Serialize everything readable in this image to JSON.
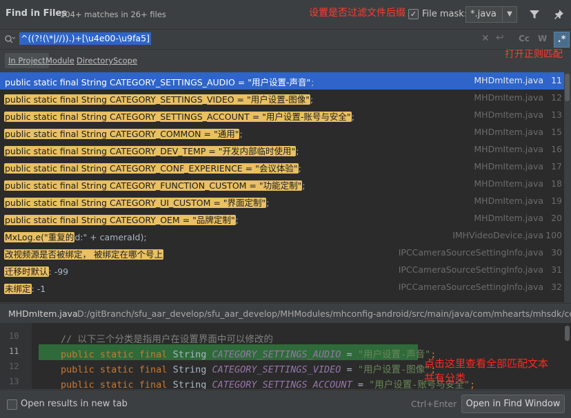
{
  "header": {
    "title": "Find in Files",
    "matches": "104+ matches in 26+ files",
    "file_mask_label": "File mask:",
    "file_mask_value": "*.java",
    "file_mask_checked": true
  },
  "annotations": {
    "filter": "设置是否过滤文件后缀",
    "regex": "打开正则匹配",
    "detail": "点击这里查看全部匹配文本共有分类"
  },
  "search": {
    "query": "^((?!(\\*|//)).)+[\\u4e00-\\u9fa5]",
    "cc_label": "Cc",
    "word_label": "W",
    "regex_label": ".*",
    "regex_enabled": true
  },
  "scopes": [
    "In Project",
    "Module",
    "Directory",
    "Scope"
  ],
  "results": [
    {
      "match": "public static final String CATEGORY_SETTINGS_AUDIO = \"用户设置-声音\"",
      "rest": ";",
      "file": "MHDmItem.java",
      "line": "11",
      "selected": true
    },
    {
      "match": "public static final String CATEGORY_SETTINGS_VIDEO = \"用户设置-图像\"",
      "rest": ";",
      "file": "MHDmItem.java",
      "line": "12"
    },
    {
      "match": "public static final String CATEGORY_SETTINGS_ACCOUNT = \"用户设置-账号与安全\"",
      "rest": ";",
      "file": "MHDmItem.java",
      "line": "13"
    },
    {
      "match": "public static final String CATEGORY_COMMON = \"通用\"",
      "rest": ";",
      "file": "MHDmItem.java",
      "line": "15"
    },
    {
      "match": "public static final String CATEGORY_DEV_TEMP = \"开发内部临时使用\"",
      "rest": ";",
      "file": "MHDmItem.java",
      "line": "16"
    },
    {
      "match": "public static final String CATEGORY_CONF_EXPERIENCE = \"会议体验\"",
      "rest": ";",
      "file": "MHDmItem.java",
      "line": "17"
    },
    {
      "match": "public static final String CATEGORY_FUNCTION_CUSTOM = \"功能定制\"",
      "rest": ";",
      "file": "MHDmItem.java",
      "line": "18"
    },
    {
      "match": "public static final String CATEGORY_UI_CUSTOM = \"界面定制\"",
      "rest": ";",
      "file": "MHDmItem.java",
      "line": "19"
    },
    {
      "match": "public static final String CATEGORY_OEM = \"品牌定制\"",
      "rest": ";",
      "file": "MHDmItem.java",
      "line": "20"
    },
    {
      "match": "MxLog.e(\"重复的",
      "rest": "d:\" + cameraId);",
      "file": "IMHVideoDevice.java",
      "line": "100"
    },
    {
      "match": "改视频源是否被绑定， 被绑定在哪个号上",
      "rest": "",
      "file": "IPCCameraSourceSettingInfo.java",
      "line": "30"
    },
    {
      "match": "迁移时默认",
      "rest": ": -99",
      "file": "IPCCameraSourceSettingInfo.java",
      "line": "31"
    },
    {
      "match": "未绑定",
      "rest": ": -1",
      "file": "IPCCameraSourceSettingInfo.java",
      "line": "32"
    }
  ],
  "path_bar": {
    "file": "MHDmItem.java",
    "dir": "D:/gitBranch/sfu_aar_develop/sfu_aar_develop/MHModules/mhconfig-android/src/main/java/com/mhearts/mhsdk/config"
  },
  "preview": {
    "lines": [
      {
        "num": "10",
        "comment": "// 以下三个分类是指用户在设置界面中可以修改的"
      },
      {
        "num": "11",
        "kw": "public static final",
        "type": "String",
        "name": "CATEGORY_SETTINGS_AUDIO",
        "eq": "=",
        "str": "\"用户设置-声音\"",
        "end": ";",
        "current": true
      },
      {
        "num": "12",
        "kw": "public static final",
        "type": "String",
        "name": "CATEGORY_SETTINGS_VIDEO",
        "eq": "=",
        "str": "\"用户设置-图像\"",
        "end": ";"
      },
      {
        "num": "13",
        "kw": "public static final",
        "type": "String",
        "name": "CATEGORY_SETTINGS_ACCOUNT",
        "eq": "=",
        "str": "\"用户设置-账号与安全\"",
        "end": ";"
      }
    ]
  },
  "footer": {
    "open_in_new_tab": "Open results in new tab",
    "shortcut": "Ctrl+Enter",
    "open_button": "Open in Find Window"
  },
  "colors": {
    "match_highlight": "#e9c062",
    "selection": "#2f65ca",
    "annotation_red": "#ff3b30"
  }
}
